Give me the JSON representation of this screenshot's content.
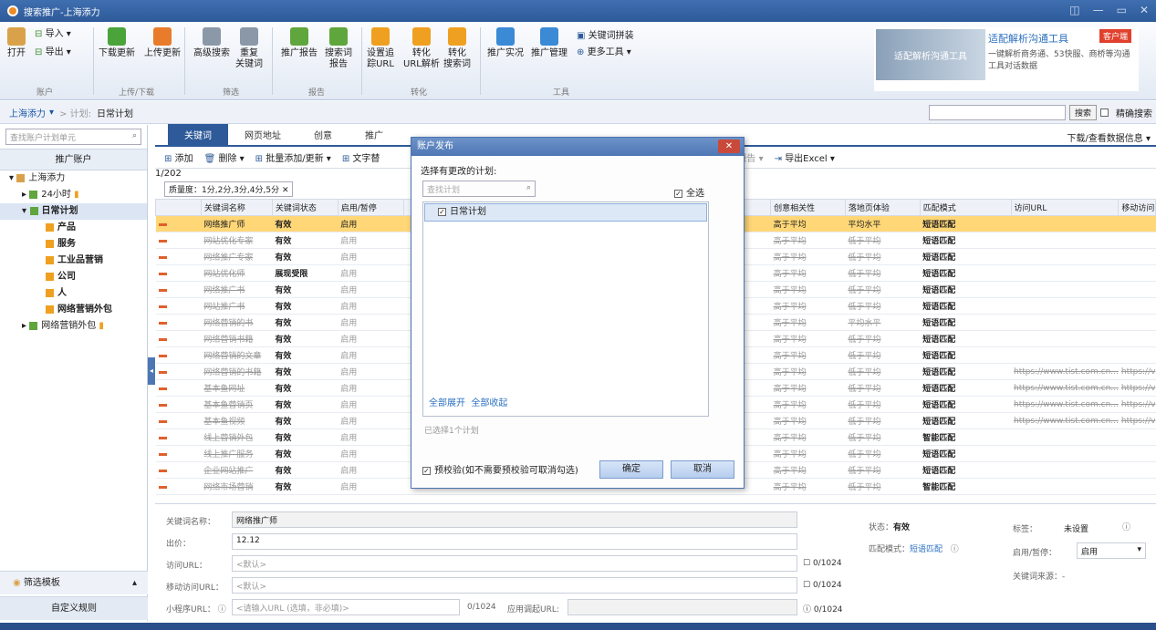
{
  "window": {
    "title": "搜索推广-上海添力"
  },
  "ribbon": {
    "groups": [
      "账户",
      "上传/下载",
      "筛选",
      "报告",
      "转化",
      "工具"
    ],
    "buttons": [
      "打开",
      "导入 ▾",
      "导出 ▾",
      "下载更新",
      "上传更新",
      "高级搜索",
      "重复\n关键词",
      "推广报告",
      "搜索词\n报告",
      "设置追\n踪URL",
      "转化\nURL解析",
      "转化\n搜索词",
      "推广实况",
      "推广管理"
    ],
    "extra": [
      "关键词拼装",
      "更多工具 ▾"
    ]
  },
  "ad": {
    "image_text": "适配解析沟通工具",
    "heading": "适配解析沟通工具",
    "tag": "客户端",
    "desc": "一键解析商务通、53快服、商桥等沟通工具对话数据"
  },
  "breadcrumb": {
    "account": "上海添力",
    "arrow": "▾",
    "sep": "> 计划:",
    "plan": "日常计划"
  },
  "topsearch": {
    "button": "搜索",
    "exact": "精确搜索"
  },
  "left": {
    "search_placeholder": "查找账户计划单元",
    "header": "推广账户",
    "tree": [
      "上海添力",
      "24小时",
      "日常计划",
      "产品",
      "服务",
      "工业品营销",
      "公司",
      "人",
      "网络营销外包",
      "网络营销外包"
    ],
    "foot1": "筛选模板",
    "foot2": "自定义规则"
  },
  "tabs": [
    "关键词",
    "网页地址",
    "创意",
    "推广"
  ],
  "tabs_right": "下载/查看数据信息 ▾",
  "toolbar": [
    "添加",
    "删除 ▾",
    "批量添加/更新 ▾",
    "文字替",
    "报告 ▾",
    "导出Excel ▾"
  ],
  "page": "1/202",
  "filter": "质量度：1分,2分,3分,4分,5分",
  "table": {
    "headers": [
      "",
      "关键词名称",
      "关键词状态",
      "启用/暂停",
      "创意相关性",
      "落地页体验",
      "匹配模式",
      "访问URL",
      "移动访问"
    ],
    "rows": [
      [
        "网络推广师",
        "有效",
        "启用",
        "高于平均",
        "平均水平",
        "短语匹配",
        "",
        ""
      ],
      [
        "网站优化专家",
        "有效",
        "启用",
        "高于平均",
        "低于平均",
        "短语匹配",
        "",
        ""
      ],
      [
        "网络推广专家",
        "有效",
        "启用",
        "高于平均",
        "低于平均",
        "短语匹配",
        "",
        ""
      ],
      [
        "网站优化师",
        "展现受限",
        "启用",
        "高于平均",
        "低于平均",
        "短语匹配",
        "",
        ""
      ],
      [
        "网络推广书",
        "有效",
        "启用",
        "高于平均",
        "低于平均",
        "短语匹配",
        "",
        ""
      ],
      [
        "网站推广书",
        "有效",
        "启用",
        "高于平均",
        "低于平均",
        "短语匹配",
        "",
        ""
      ],
      [
        "网络营销的书",
        "有效",
        "启用",
        "高于平均",
        "平均水平",
        "短语匹配",
        "",
        ""
      ],
      [
        "网络营销书籍",
        "有效",
        "启用",
        "高于平均",
        "低于平均",
        "短语匹配",
        "",
        ""
      ],
      [
        "网络营销的文章",
        "有效",
        "启用",
        "高于平均",
        "低于平均",
        "短语匹配",
        "",
        ""
      ],
      [
        "网络营销的书籍",
        "有效",
        "启用",
        "高于平均",
        "低于平均",
        "短语匹配",
        "https://www.tist.com.cn...",
        "https://v"
      ],
      [
        "基本鱼网址",
        "有效",
        "启用",
        "高于平均",
        "低于平均",
        "短语匹配",
        "https://www.tist.com.cn...",
        "https://v"
      ],
      [
        "基本鱼营销页",
        "有效",
        "启用",
        "高于平均",
        "低于平均",
        "短语匹配",
        "https://www.tist.com.cn...",
        "https://v"
      ],
      [
        "基本鱼视频",
        "有效",
        "启用",
        "高于平均",
        "低于平均",
        "短语匹配",
        "https://www.tist.com.cn...",
        "https://v"
      ],
      [
        "线上营销外包",
        "有效",
        "启用",
        "高于平均",
        "低于平均",
        "智能匹配",
        "",
        ""
      ],
      [
        "线上推广服务",
        "有效",
        "启用",
        "高于平均",
        "低于平均",
        "短语匹配",
        "",
        ""
      ],
      [
        "企业网站推广",
        "有效",
        "启用",
        "高于平均",
        "低于平均",
        "短语匹配",
        "",
        ""
      ],
      [
        "网络市场营销",
        "有效",
        "启用",
        "高于平均",
        "低于平均",
        "智能匹配",
        "",
        ""
      ]
    ]
  },
  "detail": {
    "kw_label": "关键词名称：",
    "kw_value": "网络推广师",
    "price_label": "出价：",
    "price_value": "12.12",
    "url_label": "访问URL：",
    "url_value": "<默认>",
    "url_count": "0/1024",
    "murl_label": "移动访问URL：",
    "murl_value": "<默认>",
    "murl_count": "0/1024",
    "mini_label": "小程序URL：",
    "mini_value": "<请输入URL (选填，非必填)>",
    "mini_count": "0/1024",
    "app_label": "应用调起URL:",
    "app_count": "0/1024",
    "status_label": "状态：",
    "status_value": "有效",
    "match_label": "匹配模式：",
    "match_value": "短语匹配",
    "tag_label": "标签：",
    "tag_value": "未设置",
    "pause_label": "启用/暂停：",
    "pause_value": "启用",
    "src_label": "关键词来源：",
    "src_value": "-"
  },
  "dialog": {
    "title": "账户发布",
    "question": "选择有更改的计划:",
    "search": "查找计划",
    "select_all": "全选",
    "item": "日常计划",
    "expand": "全部展开",
    "collapse": "全部收起",
    "count": "已选择1个计划",
    "precheck": "预校验(如不需要预校验可取消勾选)",
    "ok": "确定",
    "cancel": "取消"
  }
}
